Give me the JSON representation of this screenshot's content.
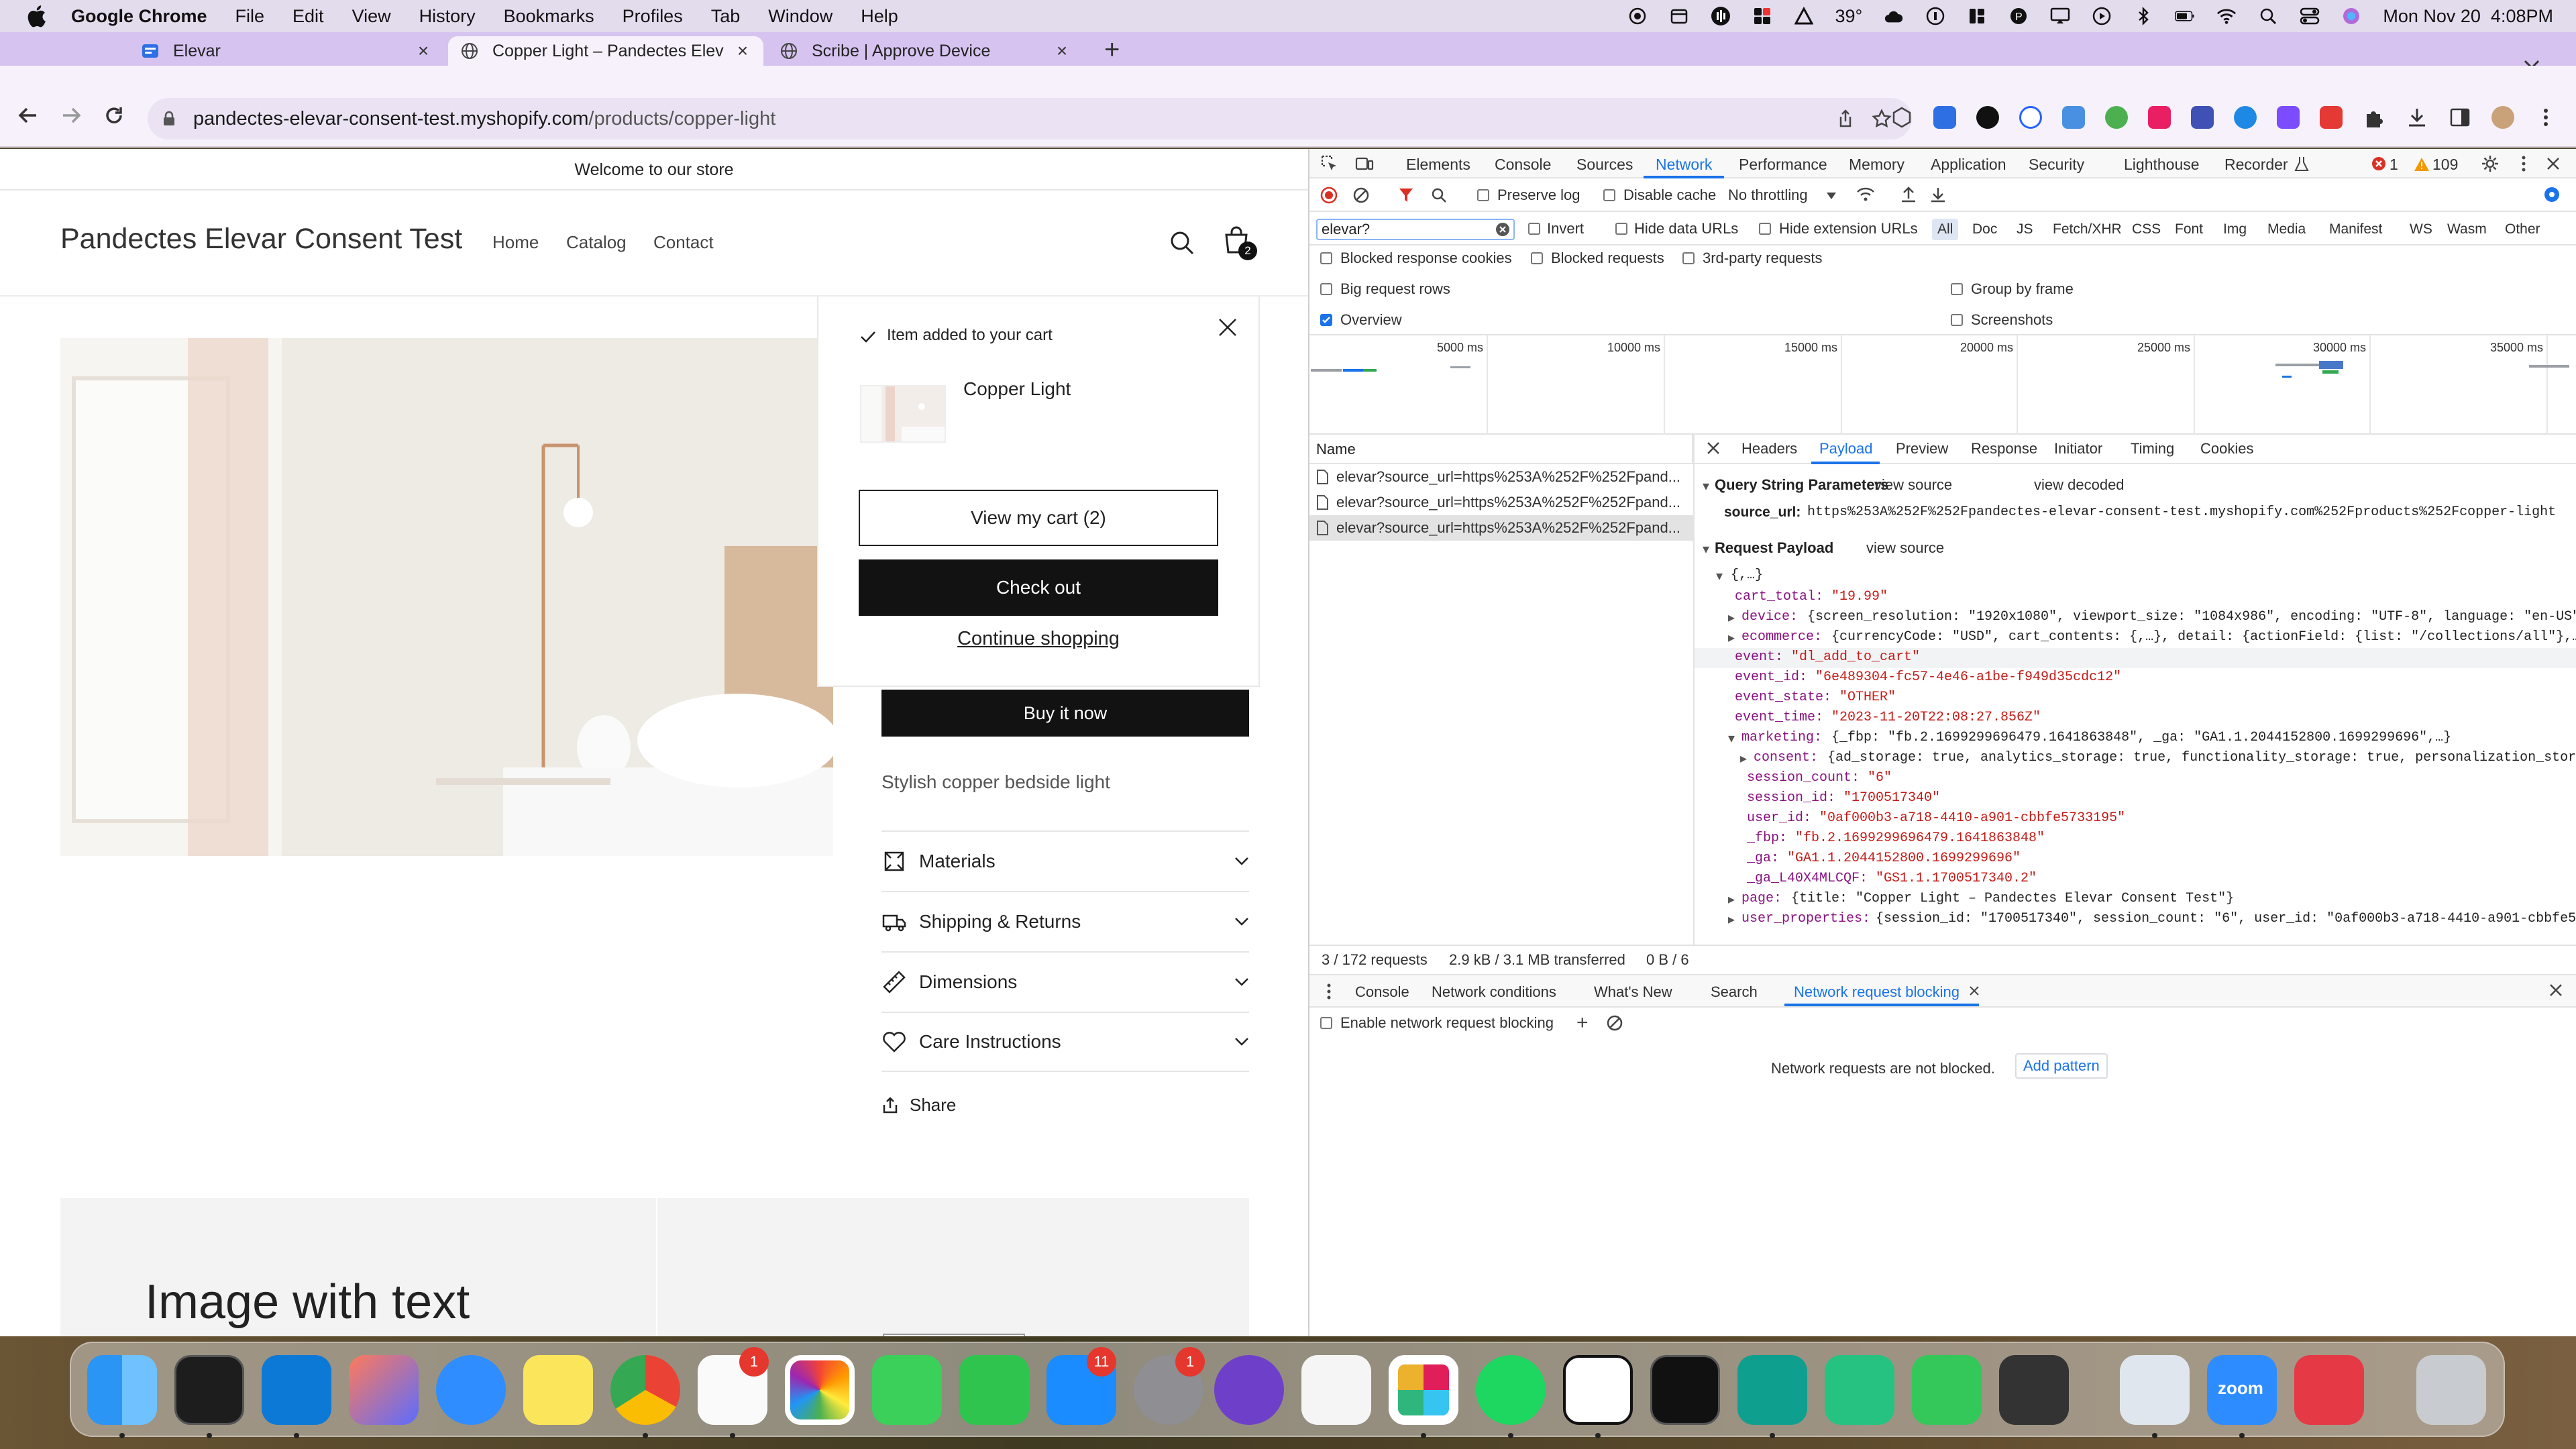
{
  "menubar": {
    "app": "Google Chrome",
    "items": [
      "File",
      "Edit",
      "View",
      "History",
      "Bookmarks",
      "Profiles",
      "Tab",
      "Window",
      "Help"
    ],
    "weather": "39°",
    "clock": "Mon Nov 20  4:08PM"
  },
  "tabs": [
    {
      "label": "Elevar"
    },
    {
      "label": "Copper Light – Pandectes Elev"
    },
    {
      "label": "Scribe | Approve Device"
    }
  ],
  "address": {
    "host": "pandectes-elevar-consent-test.myshopify.com",
    "path": "/products/copper-light"
  },
  "store": {
    "announcement": "Welcome to our store",
    "name": "Pandectes Elevar Consent Test",
    "nav": [
      "Home",
      "Catalog",
      "Contact"
    ],
    "cart_count": "2",
    "buy_now": "Buy it now",
    "description": "Stylish copper bedside light",
    "accordions": [
      "Materials",
      "Shipping & Returns",
      "Dimensions",
      "Care Instructions"
    ],
    "share": "Share",
    "image_with_text": "Image with text"
  },
  "popup": {
    "message": "Item added to your cart",
    "product": "Copper Light",
    "view_cart": "View my cart (2)",
    "checkout": "Check out",
    "continue": "Continue shopping"
  },
  "devtools": {
    "tabs": [
      "Elements",
      "Console",
      "Sources",
      "Network",
      "Performance",
      "Memory",
      "Application",
      "Security",
      "Lighthouse",
      "Recorder"
    ],
    "errors": "1",
    "warnings": "109",
    "preserve_log": "Preserve log",
    "disable_cache": "Disable cache",
    "throttling": "No throttling",
    "filter_value": "elevar?",
    "invert": "Invert",
    "hide_data_urls": "Hide data URLs",
    "hide_ext_urls": "Hide extension URLs",
    "filter_types": [
      "All",
      "Doc",
      "JS",
      "Fetch/XHR",
      "CSS",
      "Font",
      "Img",
      "Media",
      "Manifest",
      "WS",
      "Wasm",
      "Other"
    ],
    "blocked_cookies": "Blocked response cookies",
    "blocked_requests": "Blocked requests",
    "third_party": "3rd-party requests",
    "big_rows": "Big request rows",
    "group_by_frame": "Group by frame",
    "overview": "Overview",
    "screenshots": "Screenshots",
    "timeline_ticks": [
      "5000 ms",
      "10000 ms",
      "15000 ms",
      "20000 ms",
      "25000 ms",
      "30000 ms",
      "35000 ms"
    ],
    "name_header": "Name",
    "requests": [
      "elevar?source_url=https%253A%252F%252Fpand...",
      "elevar?source_url=https%253A%252F%252Fpand...",
      "elevar?source_url=https%253A%252F%252Fpand..."
    ],
    "detail_tabs": [
      "Headers",
      "Payload",
      "Preview",
      "Response",
      "Initiator",
      "Timing",
      "Cookies"
    ],
    "qs_title": "Query String Parameters",
    "view_source": "view source",
    "view_decoded": "view decoded",
    "source_url_key": "source_url:",
    "source_url_val": "https%253A%252F%252Fpandectes-elevar-consent-test.myshopify.com%252Fproducts%252Fcopper-light",
    "payload_title": "Request Payload",
    "payload": {
      "root": "{,…}",
      "cart_total": "\"19.99\"",
      "device": "{screen_resolution: \"1920x1080\", viewport_size: \"1084x986\", encoding: \"UTF-8\", language: \"en-US\"",
      "ecommerce": "{currencyCode: \"USD\", cart_contents: {,…}, detail: {actionField: {list: \"/collections/all\"},…",
      "event": "\"dl_add_to_cart\"",
      "event_id": "\"6e489304-fc57-4e46-a1be-f949d35cdc12\"",
      "event_state": "\"OTHER\"",
      "event_time": "\"2023-11-20T22:08:27.856Z\"",
      "marketing": "{_fbp: \"fb.2.1699299696479.1641863848\", _ga: \"GA1.1.2044152800.1699299696\",…}",
      "consent": "{ad_storage: true, analytics_storage: true, functionality_storage: true, personalization_stora",
      "session_count": "\"6\"",
      "session_id": "\"1700517340\"",
      "user_id": "\"0af000b3-a718-4410-a901-cbbfe5733195\"",
      "_fbp": "\"fb.2.1699299696479.1641863848\"",
      "_ga": "\"GA1.1.2044152800.1699299696\"",
      "_ga_L40X4MLCQF": "\"GS1.1.1700517340.2\"",
      "page": "{title: \"Copper Light – Pandectes Elevar Consent Test\"}",
      "user_properties": "{session_id: \"1700517340\", session_count: \"6\", user_id: \"0af000b3-a718-4410-a901-cbbfe5"
    },
    "summary": [
      "3 / 172 requests",
      "2.9 kB / 3.1 MB transferred",
      "0 B / 6"
    ],
    "drawer_tabs": [
      "Console",
      "Network conditions",
      "What's New",
      "Search",
      "Network request blocking"
    ],
    "enable_blocking": "Enable network request blocking",
    "not_blocked": "Network requests are not blocked.",
    "add_pattern": "Add pattern"
  },
  "dock": {
    "reminders_badge": "1",
    "appstore_badge": "11",
    "settings_badge": "1",
    "zoom_label": "zoom"
  }
}
